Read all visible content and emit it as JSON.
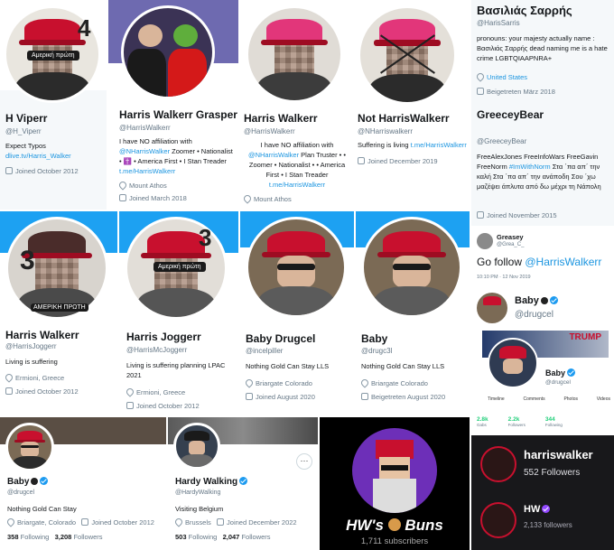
{
  "profiles": [
    {
      "name": "H Viperr",
      "handle": "@H_Viperr",
      "bio": "Expect Typos",
      "link": "dlive.tv/Harris_Walker",
      "joined": "Joined October 2012",
      "overlay_number": "4",
      "overlay_tag": "Αμερική πρώτη"
    },
    {
      "name": "Harris Walkerr Grasper",
      "handle": "@HarrisWalkerr",
      "bio_pre": "I have NO affiliation with",
      "bio_link": "@NHarrisWalker",
      "bio_post": " Zoomer • Nationalist • ✝️ • America First • I Stan Treader",
      "link": "t.me/HarrisWalkerr",
      "location": "Mount Athos",
      "joined": "Joined March 2018"
    },
    {
      "name": "Harris Walkerr",
      "handle": "@HarrisWalkerr",
      "bio_pre": "I have NO affiliation with",
      "bio_link": "@NHarrisWalker",
      "bio_post": " Plan Truster • • Zoomer • Nationalist • • America First • I Stan Treader",
      "link": "t.me/HarrisWalkerr",
      "location": "Mount Athos"
    },
    {
      "name": "Not HarrisWalkerr",
      "handle": "@NHarriswalkerr",
      "bio_pre": "Suffering is living ",
      "link": "t.me/HarrisWalkerr",
      "joined": "Joined December 2019"
    },
    {
      "name": "Βασιλιάς Σαρρής",
      "handle": "@HarisSarris",
      "bio": "pronouns: your majesty actually name : Βασιλιάς Σαρρής dead naming me is a hate crime LGBTQIAAPNRA+",
      "location": "United States",
      "joined": "Beigetreten März 2018"
    },
    {
      "name": "GreeceyBear",
      "handle": "@GreeceyBear",
      "bio_pre": "FreeAlexJones FreeInfoWars FreeGavin FreeNorm ",
      "bio_link": "#ImWithNorm",
      "bio_post": " Στα ΄πα απ΄ την καλή Στα ΄πα απ΄ την ανάποδη Σου ΄χω μαζέψει άπλυτα από δω μέχρι τη Νάπολη",
      "joined": "Joined November 2015"
    },
    {
      "name": "Harris Walkerr",
      "handle": "@HarrisJoggerr",
      "bio": "Living is suffering",
      "location": "Ermioni, Greece",
      "joined": "Joined October 2012",
      "overlay_number": "3",
      "overlay_tag": "ΑΜΕΡΙΚΗ ΠΡΩΤΗ"
    },
    {
      "name": "Harris Joggerr",
      "handle": "@HarrisMcJoggerr",
      "bio": "Living is suffering planning LPAC 2021",
      "location": "Ermioni, Greece",
      "joined": "Joined October 2012",
      "overlay_number": "3",
      "overlay_tag": "Αμερική πρώτη"
    },
    {
      "name": "Baby Drugcel",
      "handle": "@incelpiller",
      "bio": "Nothing Gold Can Stay LLS",
      "location": "Briargate Colorado",
      "joined": "Joined August 2020"
    },
    {
      "name": "Baby",
      "handle": "@drugc3l",
      "bio": "Nothing Gold Can Stay LLS",
      "location": "Briargate Colorado",
      "joined": "Beigetreten August 2020"
    }
  ],
  "tweet": {
    "author": "Greasey",
    "author_handle": "@Grea_C_",
    "text_pre": "Go follow ",
    "text_link": "@HarrisWalkerr",
    "time": "10:10 PM · 12 Nov 2019"
  },
  "card_baby": {
    "name": "Baby",
    "handle": "@drugcel",
    "banner_text": "TRUMP",
    "inner_name": "Baby",
    "inner_handle": "@drugcel",
    "tabs": [
      "Timeline",
      "Comments",
      "Photos",
      "Videos"
    ],
    "stats": [
      {
        "value": "2.8k",
        "label": "Gabs"
      },
      {
        "value": "2.2k",
        "label": "Followers"
      },
      {
        "value": "344",
        "label": "Following"
      }
    ]
  },
  "bottom_baby": {
    "name": "Baby",
    "handle": "@drugcel",
    "bio": "Nothing Gold Can Stay",
    "location": "Briargate, Colorado",
    "joined": "Joined October 2012",
    "following": "358",
    "following_label": "Following",
    "followers": "3,208",
    "followers_label": "Followers"
  },
  "hardy": {
    "name": "Hardy Walking",
    "handle": "@HardyWalking",
    "bio": "Visiting Belgium",
    "location": "Brussels",
    "joined": "Joined December 2022",
    "following": "503",
    "following_label": "Following",
    "followers": "2,047",
    "followers_label": "Followers",
    "menu": "···"
  },
  "youtube": {
    "title_pre": "HW's",
    "title_post": "Buns",
    "subscribers": "1,711 subscribers"
  },
  "channels": [
    {
      "name": "harriswalker",
      "followers": "552 Followers"
    },
    {
      "name": "HW",
      "followers": "2,133 followers"
    }
  ],
  "colors": {
    "twitter_blue": "#1da1f2",
    "link_blue": "#1b95e0",
    "maga_red": "#c8102e",
    "gab_green": "#21cf7a"
  }
}
